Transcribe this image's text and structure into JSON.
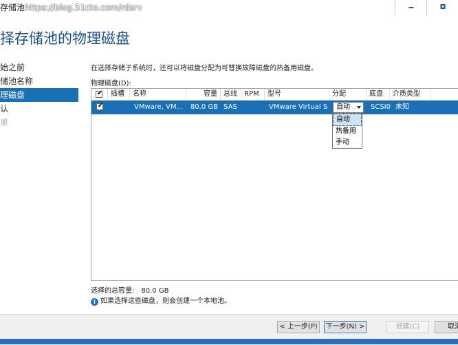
{
  "window": {
    "title_prefix": "存储池",
    "watermark_url": "https://blog.51cto.com/rdsrv"
  },
  "heading": "择存储池的物理磁盘",
  "nav": {
    "items": [
      {
        "label": "始之前",
        "state": "normal"
      },
      {
        "label": "储池名称",
        "state": "normal"
      },
      {
        "label": "理磁盘",
        "state": "active"
      },
      {
        "label": "认",
        "state": "normal"
      },
      {
        "label": "果",
        "state": "disabled"
      }
    ]
  },
  "description": "在选择存储子系统时，还可以将磁盘分配为可替换故障磁盘的热备用磁盘。",
  "disks_label": "物理磁盘(D):",
  "grid": {
    "columns": [
      "插槽",
      "名称",
      "容量",
      "总线",
      "RPM",
      "型号",
      "分配",
      "底盘",
      "介质类型"
    ],
    "rows": [
      {
        "checked": true,
        "slot": "",
        "name": "VMware, VM...",
        "capacity": "80.0 GB",
        "bus": "SAS",
        "rpm": "",
        "model": "VMware Virtual S",
        "allocation": "自动",
        "chassis": "SCSI0",
        "media": "未知"
      }
    ],
    "allocation_options": [
      "自动",
      "热备用",
      "手动"
    ],
    "selected_option": "自动"
  },
  "summary": {
    "label": "选择的总容量:",
    "value": "80.0 GB"
  },
  "info_text": "如果选择这些磁盘，则会创建一个本地池。",
  "buttons": {
    "prev": "< 上一步(P)",
    "next": "下一步(N) >",
    "create": "创建(C)",
    "cancel": "取消"
  },
  "colors": {
    "accent": "#1a6fb5",
    "heading": "#1a4f88"
  }
}
